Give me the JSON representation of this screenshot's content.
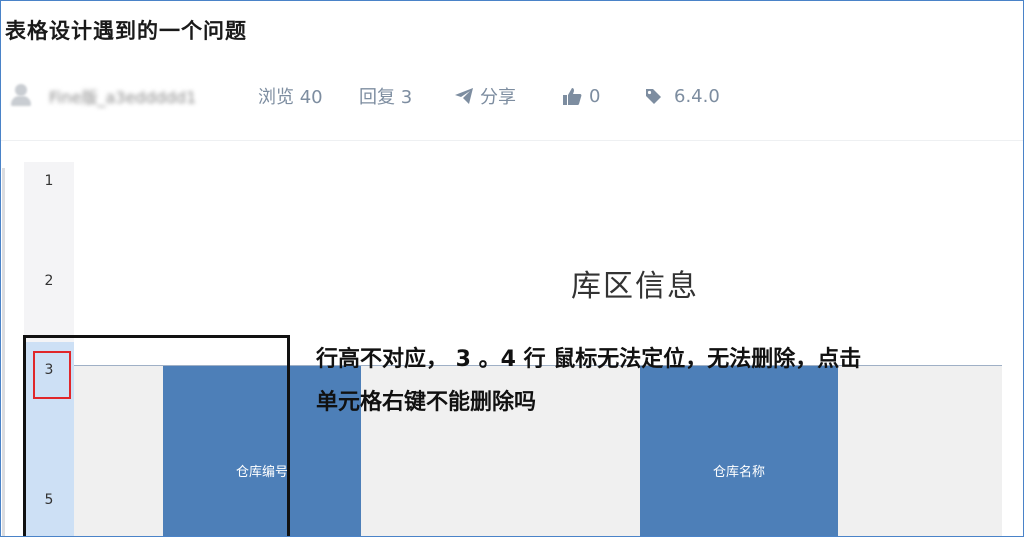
{
  "post": {
    "title": "表格设计遇到的一个问题"
  },
  "meta": {
    "author": "Fine版_a3eddddd1",
    "views": "浏览 40",
    "replies": "回复 3",
    "share": "分享",
    "likes": "0",
    "version": "6.4.0"
  },
  "sheet": {
    "row_numbers": [
      "1",
      "2",
      "3",
      "5"
    ],
    "sheet_title": "库区信息",
    "annotation_line1": "行高不对应， 3 。4 行 鼠标无法定位，无法删除，点击",
    "annotation_line2": "单元格右键不能删除吗",
    "headers": {
      "warehouse_code": "仓库编号",
      "warehouse_name": "仓库名称"
    }
  },
  "colors": {
    "accent_blue": "#4d7fb8",
    "highlight_red": "#e0262a",
    "meta_grey": "#7d8da0"
  }
}
